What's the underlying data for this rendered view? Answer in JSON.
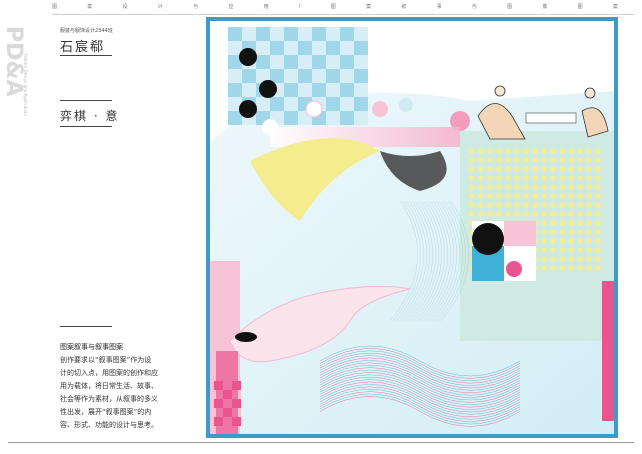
{
  "header": {
    "nav_chars": [
      "图",
      "案",
      "设",
      "计",
      "与",
      "应",
      "用",
      "/",
      "图",
      "案",
      "叙",
      "事",
      "与",
      "图",
      "像",
      "图",
      "案"
    ]
  },
  "brand": {
    "logo": "PD&A",
    "subtitle": "Pattern Design and Application"
  },
  "author": {
    "course": "服装与服饰设计2344班",
    "name": "石宸郗"
  },
  "work": {
    "title": "弈棋 · 意"
  },
  "description": {
    "title": "图案叙事与叙事图案",
    "lines": [
      "创作要求以“叙事图案”作为设",
      "计的切入点，用图案的创作和应",
      "用为载体，将日常生活、故事、",
      "社会等作为素材，从叙事的多义",
      "性出发，展开“叙事图案”的内",
      "容、形式、功能的设计与思考。"
    ]
  },
  "colors": {
    "frame": "#3d9bc6",
    "sky": "#9fd6e8",
    "pink": "#e9558f",
    "light_pink": "#f6c4d6",
    "yellow": "#f4ec8d",
    "mint": "#cfe9e3",
    "cyan": "#3fb1d6"
  }
}
